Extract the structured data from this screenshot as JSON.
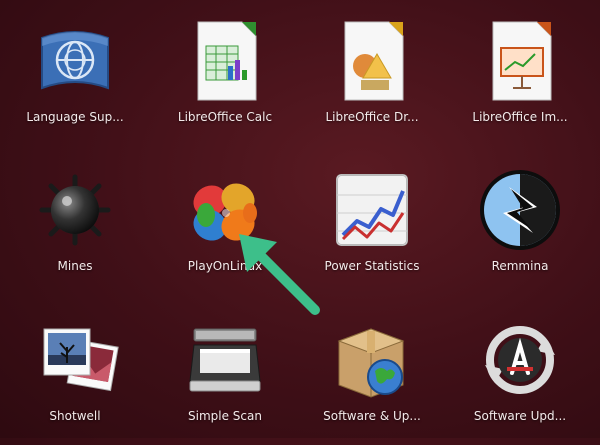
{
  "apps": [
    {
      "label": "Language Sup...",
      "icon": "language-support-icon"
    },
    {
      "label": "LibreOffice Calc",
      "icon": "libreoffice-calc-icon"
    },
    {
      "label": "LibreOffice Dr...",
      "icon": "libreoffice-draw-icon"
    },
    {
      "label": "LibreOffice Im...",
      "icon": "libreoffice-impress-icon"
    },
    {
      "label": "Mines",
      "icon": "mines-icon"
    },
    {
      "label": "PlayOnLinux",
      "icon": "playonlinux-icon"
    },
    {
      "label": "Power Statistics",
      "icon": "power-statistics-icon"
    },
    {
      "label": "Remmina",
      "icon": "remmina-icon"
    },
    {
      "label": "Shotwell",
      "icon": "shotwell-icon"
    },
    {
      "label": "Simple Scan",
      "icon": "simple-scan-icon"
    },
    {
      "label": "Software & Up...",
      "icon": "software-updates-icon"
    },
    {
      "label": "Software Upd...",
      "icon": "software-updater-icon"
    }
  ],
  "colors": {
    "background": "#3f0f17",
    "highlight_arrow": "#3dbf8a",
    "label_text": "#f4eaea"
  }
}
